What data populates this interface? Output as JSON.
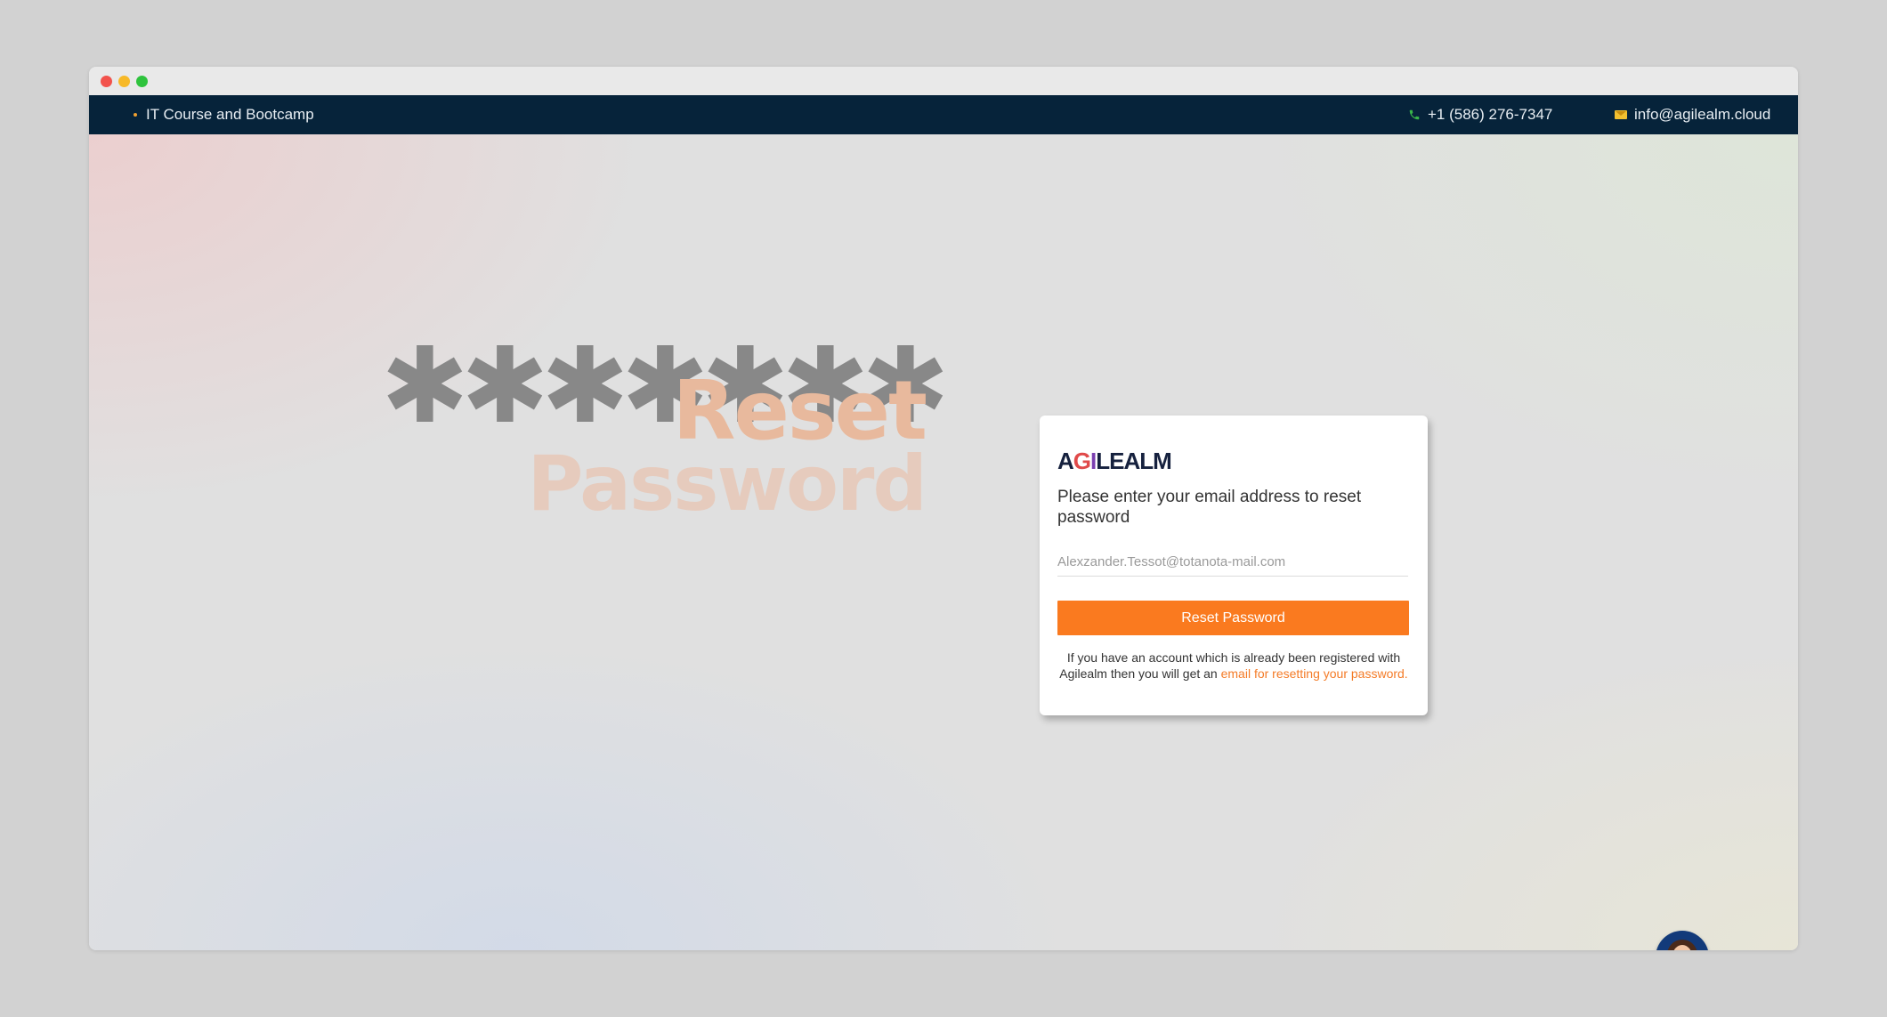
{
  "window": {
    "controls": [
      "close",
      "minimize",
      "maximize"
    ]
  },
  "topbar": {
    "tagline": "IT Course and Bootcamp",
    "phone": "+1 (586) 276-7347",
    "email": "info@agilealm.cloud",
    "icons": {
      "phone": "phone-icon",
      "email": "mail-icon"
    }
  },
  "hero": {
    "stars": [
      "✱",
      "✱",
      "✱",
      "✱",
      "✱",
      "✱",
      "✱"
    ],
    "line1": "Reset",
    "line2": "Password"
  },
  "card": {
    "logo": {
      "part1": "A",
      "part2": "G",
      "part3": "I",
      "part4": "LEALM"
    },
    "prompt": "Please enter your email address to reset password",
    "email_value": "Alexzander.Tessot@totanota-mail.com",
    "button_label": "Reset Password",
    "note_text": "If you have an account which is already been registered with Agilealm then you will get an ",
    "note_link": "email for resetting your password."
  },
  "colors": {
    "topbar": "#06233a",
    "accent": "#fa7a1f",
    "hero_reset": "#e8b99d",
    "hero_password": "#e6cbbd"
  }
}
